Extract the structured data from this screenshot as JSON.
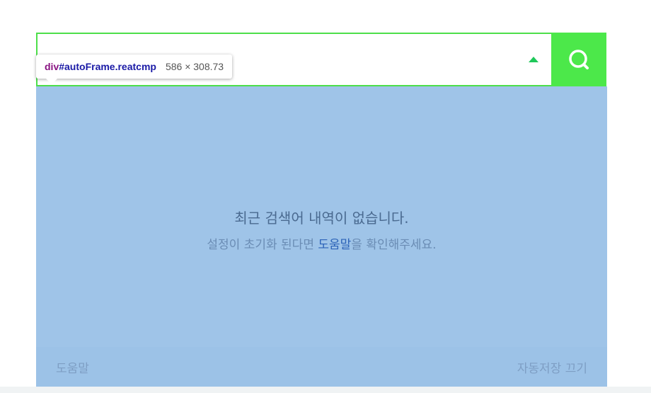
{
  "search": {
    "value": "",
    "placeholder": ""
  },
  "devtools_tooltip": {
    "tag": "div",
    "selector": "#autoFrame.reatcmp",
    "dimensions": "586 × 308.73"
  },
  "dropdown": {
    "empty_title": "최근 검색어 내역이 없습니다.",
    "empty_sub_before": "설정이 초기화 된다면 ",
    "empty_sub_link": "도움말",
    "empty_sub_after": "을 확인해주세요.",
    "footer_help": "도움말",
    "footer_autosave": "자동저장 끄기"
  },
  "icons": {
    "search_button": "search-icon",
    "toggle": "arrow-up-icon"
  },
  "colors": {
    "accent_green": "#4ce84a",
    "toggle_green": "#1fc85a",
    "highlight_overlay": "#9fc4e8"
  }
}
